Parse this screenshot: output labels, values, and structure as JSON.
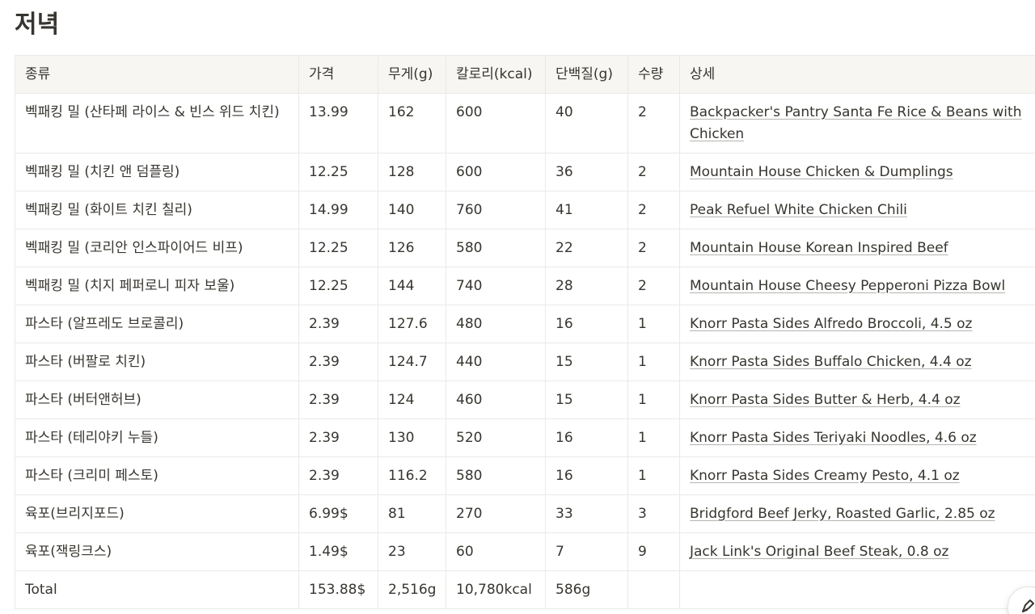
{
  "page": {
    "title": "저녁"
  },
  "table": {
    "headers": [
      "종류",
      "가격",
      "무게(g)",
      "칼로리(kcal)",
      "단백질(g)",
      "수량",
      "상세"
    ],
    "rows": [
      [
        "벡패킹 밀 (산타페 라이스 & 빈스 위드 치킨)",
        "13.99",
        "162",
        "600",
        "40",
        "2",
        "Backpacker's Pantry Santa Fe Rice & Beans with Chicken"
      ],
      [
        "벡패킹 밀 (치킨 앤 덤플링)",
        "12.25",
        "128",
        "600",
        "36",
        "2",
        "Mountain House Chicken & Dumplings"
      ],
      [
        "벡패킹 밀 (화이트 치킨 칠리)",
        "14.99",
        "140",
        "760",
        "41",
        "2",
        "Peak Refuel White Chicken Chili"
      ],
      [
        "벡패킹 밀 (코리안 인스파이어드 비프)",
        "12.25",
        "126",
        "580",
        "22",
        "2",
        "Mountain House Korean Inspired Beef"
      ],
      [
        "벡패킹 밀 (치지 페퍼로니 피자 보울)",
        "12.25",
        "144",
        "740",
        "28",
        "2",
        "Mountain House Cheesy Pepperoni Pizza Bowl"
      ],
      [
        "파스타 (알프레도 브로콜리)",
        "2.39",
        "127.6",
        "480",
        "16",
        "1",
        "Knorr Pasta Sides Alfredo Broccoli, 4.5 oz"
      ],
      [
        "파스타 (버팔로 치킨)",
        "2.39",
        "124.7",
        "440",
        "15",
        "1",
        "Knorr Pasta Sides Buffalo Chicken, 4.4 oz"
      ],
      [
        "파스타 (버터앤허브)",
        "2.39",
        "124",
        "460",
        "15",
        "1",
        "Knorr Pasta Sides Butter & Herb, 4.4 oz"
      ],
      [
        "파스타 (테리야키 누들)",
        "2.39",
        "130",
        "520",
        "16",
        "1",
        "Knorr Pasta Sides Teriyaki Noodles, 4.6 oz"
      ],
      [
        "파스타 (크리미 페스토)",
        "2.39",
        "116.2",
        "580",
        "16",
        "1",
        "Knorr Pasta Sides Creamy Pesto, 4.1 oz"
      ],
      [
        "육포(브리지포드)",
        "6.99$",
        "81",
        "270",
        "33",
        "3",
        "Bridgford Beef Jerky, Roasted Garlic, 2.85 oz"
      ],
      [
        "육포(잭링크스)",
        "1.49$",
        "23",
        "60",
        "7",
        "9",
        "Jack Link's Original Beef Steak, 0.8 oz"
      ]
    ],
    "total": [
      "Total",
      "153.88$",
      "2,516g",
      "10,780kcal",
      "586g",
      "",
      ""
    ]
  },
  "colors": {
    "header_bg": "#f7f6f3",
    "border": "#e9e9e7",
    "text": "#37352f"
  },
  "icons": {
    "floating_button": "pen-icon"
  }
}
